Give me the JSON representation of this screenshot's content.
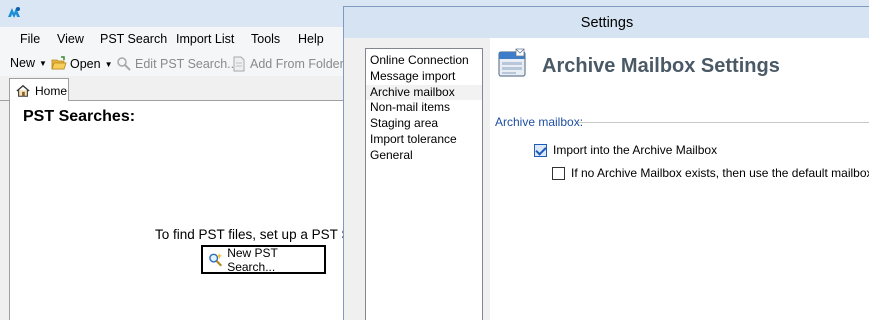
{
  "app": {
    "menu": [
      "File",
      "View",
      "PST Search",
      "Import List",
      "Tools",
      "Help"
    ],
    "toolbar": {
      "new_label": "New",
      "open_label": "Open",
      "edit_label": "Edit PST Search...",
      "add_label": "Add From Folder..."
    },
    "tab_home": "Home",
    "heading": "PST Searches:",
    "find_text": "To find PST files, set up a PST Se",
    "new_search_button": "New PST Search..."
  },
  "settings": {
    "title": "Settings",
    "nav_items": [
      "Online Connection",
      "Message import",
      "Archive mailbox",
      "Non-mail items",
      "Staging area",
      "Import tolerance",
      "General"
    ],
    "selected_nav": "Archive mailbox",
    "panel_title": "Archive Mailbox Settings",
    "group_label": "Archive mailbox:",
    "options": [
      {
        "label": "Import into the Archive Mailbox",
        "checked": true
      },
      {
        "label": "If no Archive Mailbox exists, then use the default mailbox",
        "checked": false
      }
    ]
  },
  "colors": {
    "accent": "#1f4fa1",
    "dialog_title_bg": "#d6e3f2",
    "panel_title": "#4a5966"
  }
}
